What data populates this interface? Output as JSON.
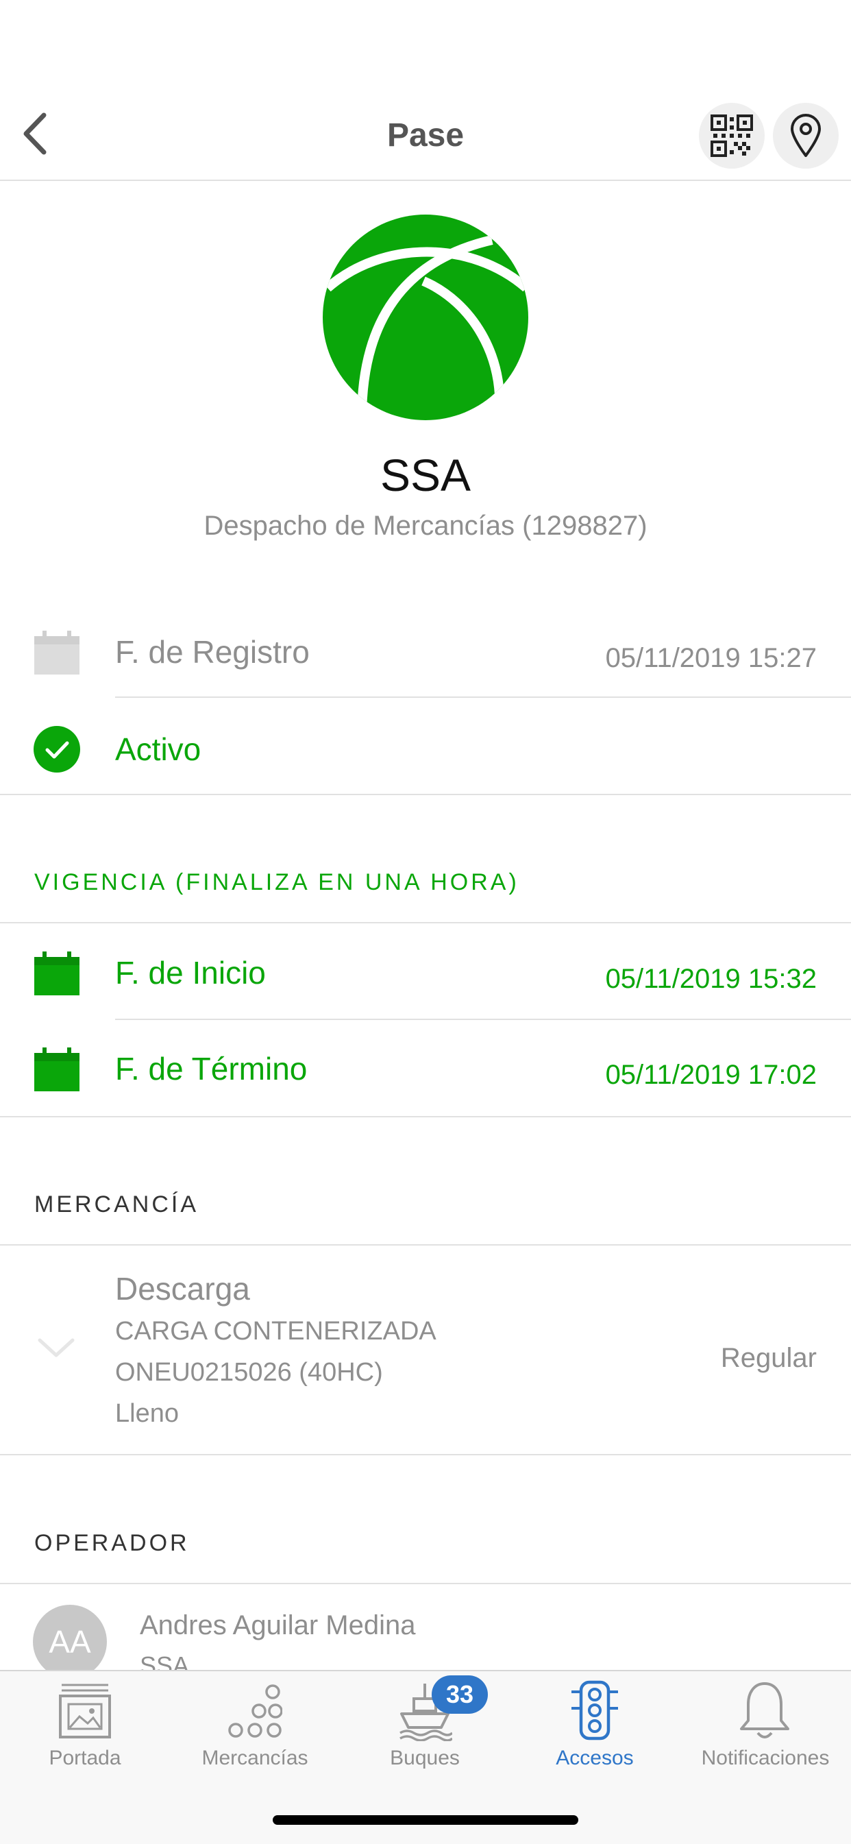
{
  "nav": {
    "title": "Pase",
    "back_icon": "chevron-left-icon",
    "qr_icon": "qr-code-icon",
    "location_icon": "map-pin-icon"
  },
  "org": {
    "name": "SSA",
    "subtitle": "Despacho de Mercancías (1298827)",
    "logo_color": "#0aa60a"
  },
  "registro": {
    "label": "F. de Registro",
    "value": "05/11/2019 15:27"
  },
  "status": {
    "label": "Activo"
  },
  "vigencia": {
    "header": "VIGENCIA (FINALIZA EN UNA HORA)",
    "inicio": {
      "label": "F. de Inicio",
      "value": "05/11/2019 15:32"
    },
    "termino": {
      "label": "F. de Término",
      "value": "05/11/2019 17:02"
    }
  },
  "mercancia": {
    "header": "MERCANCÍA",
    "type": "Descarga",
    "cargo": "CARGA CONTENERIZADA",
    "container": "ONEU0215026 (40HC)",
    "state": "Lleno",
    "class": "Regular"
  },
  "operador": {
    "header": "OPERADOR",
    "initials": "AA",
    "name": "Andres Aguilar Medina",
    "company": "SSA"
  },
  "tabs": [
    {
      "label": "Portada",
      "icon": "image-frame-icon"
    },
    {
      "label": "Mercancías",
      "icon": "dots-pyramid-icon"
    },
    {
      "label": "Buques",
      "icon": "ship-icon",
      "badge": "33"
    },
    {
      "label": "Accesos",
      "icon": "traffic-light-icon"
    },
    {
      "label": "Notificaciones",
      "icon": "bell-icon"
    }
  ],
  "colors": {
    "accent_green": "#0aa60a",
    "tab_active": "#2f76c8",
    "badge": "#2f76c8"
  }
}
